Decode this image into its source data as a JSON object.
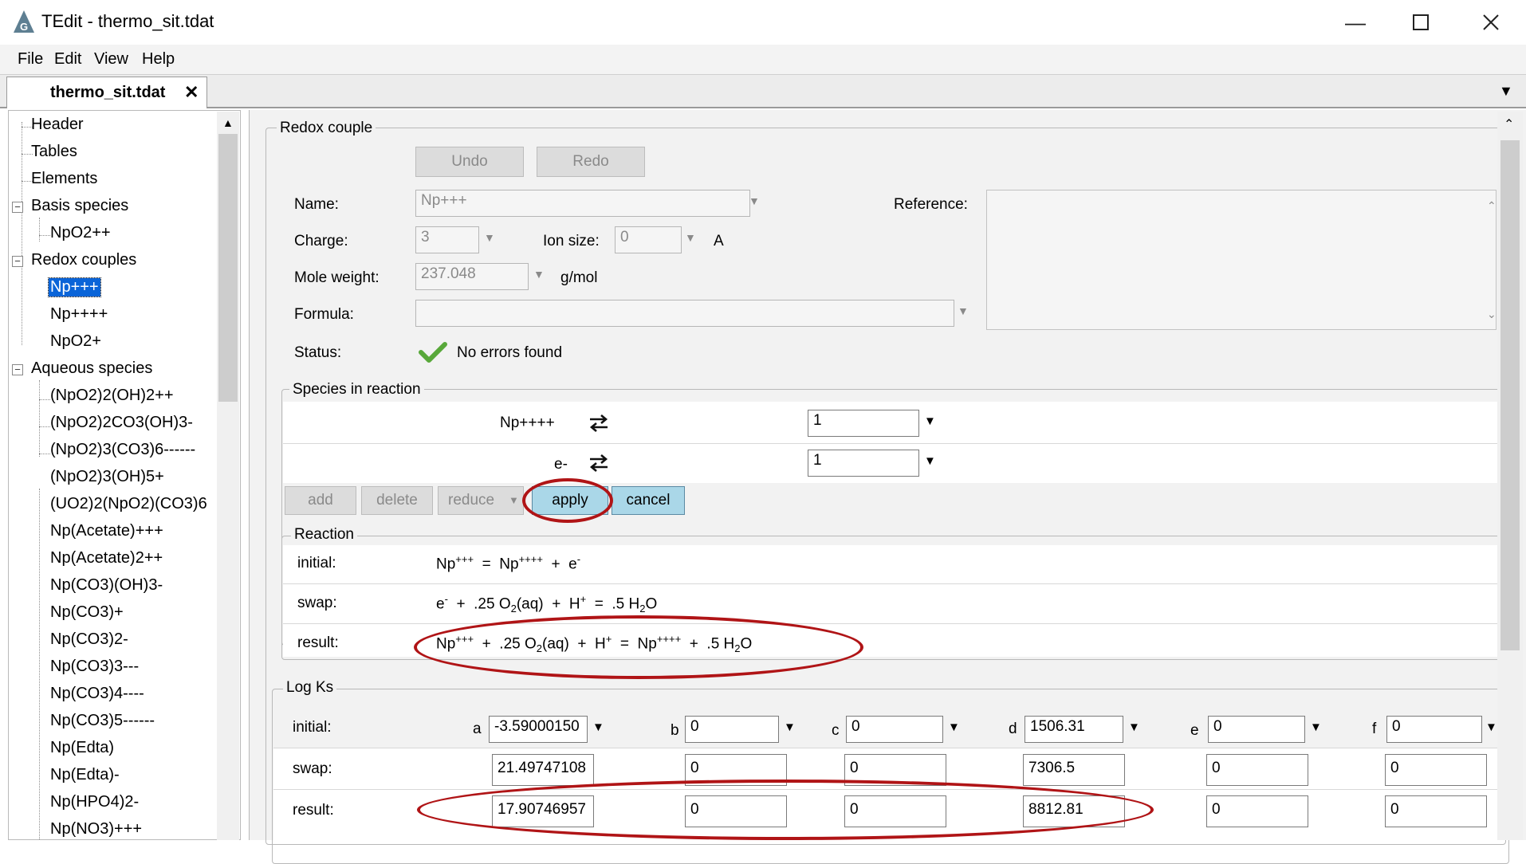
{
  "window": {
    "title": "TEdit - thermo_sit.tdat"
  },
  "menu": {
    "file": "File",
    "edit": "Edit",
    "view": "View",
    "help": "Help"
  },
  "tab": {
    "label": "thermo_sit.tdat"
  },
  "tree": {
    "header": "Header",
    "tables": "Tables",
    "elements": "Elements",
    "basis_species": "Basis species",
    "basis_children": [
      "NpO2++"
    ],
    "redox_couples": "Redox couples",
    "redox_children": [
      "Np+++",
      "Np++++",
      "NpO2+"
    ],
    "aqueous_species": "Aqueous species",
    "aqueous_children": [
      "(NpO2)2(OH)2++",
      "(NpO2)2CO3(OH)3-",
      "(NpO2)3(CO3)6------",
      "(NpO2)3(OH)5+",
      "(UO2)2(NpO2)(CO3)6",
      "Np(Acetate)+++",
      "Np(Acetate)2++",
      "Np(CO3)(OH)3-",
      "Np(CO3)+",
      "Np(CO3)2-",
      "Np(CO3)3---",
      "Np(CO3)4----",
      "Np(CO3)5------",
      "Np(Edta)",
      "Np(Edta)-",
      "Np(HPO4)2-",
      "Np(NO3)+++"
    ]
  },
  "redox": {
    "legend": "Redox couple",
    "undo": "Undo",
    "redo": "Redo",
    "name_label": "Name:",
    "name_value": "Np+++",
    "reference_label": "Reference:",
    "charge_label": "Charge:",
    "charge_value": "3",
    "ion_size_label": "Ion size:",
    "ion_size_value": "0",
    "ion_size_unit": "A",
    "mole_weight_label": "Mole weight:",
    "mole_weight_value": "237.048",
    "mole_weight_unit": "g/mol",
    "formula_label": "Formula:",
    "status_label": "Status:",
    "status_value": "No errors found"
  },
  "species": {
    "legend": "Species in reaction",
    "rows": [
      {
        "name": "Np++++",
        "coef": "1"
      },
      {
        "name": "e-",
        "coef": "1"
      }
    ],
    "add": "add",
    "delete": "delete",
    "reduce": "reduce",
    "apply": "apply",
    "cancel": "cancel"
  },
  "reaction": {
    "legend": "Reaction",
    "initial_label": "initial:",
    "swap_label": "swap:",
    "result_label": "result:"
  },
  "logks": {
    "legend": "Log Ks",
    "initial_label": "initial:",
    "swap_label": "swap:",
    "result_label": "result:",
    "params": [
      "a",
      "b",
      "c",
      "d",
      "e",
      "f"
    ],
    "initial": [
      "-3.59000150",
      "0",
      "0",
      "1506.31",
      "0",
      "0"
    ],
    "swap": [
      "21.49747108",
      "0",
      "0",
      "7306.5",
      "0",
      "0"
    ],
    "result": [
      "17.90746957",
      "0",
      "0",
      "8812.81",
      "0",
      "0"
    ]
  },
  "colors": {
    "selection": "#0a64d8",
    "annotation": "#b01416",
    "active_button": "#aad7e8"
  }
}
